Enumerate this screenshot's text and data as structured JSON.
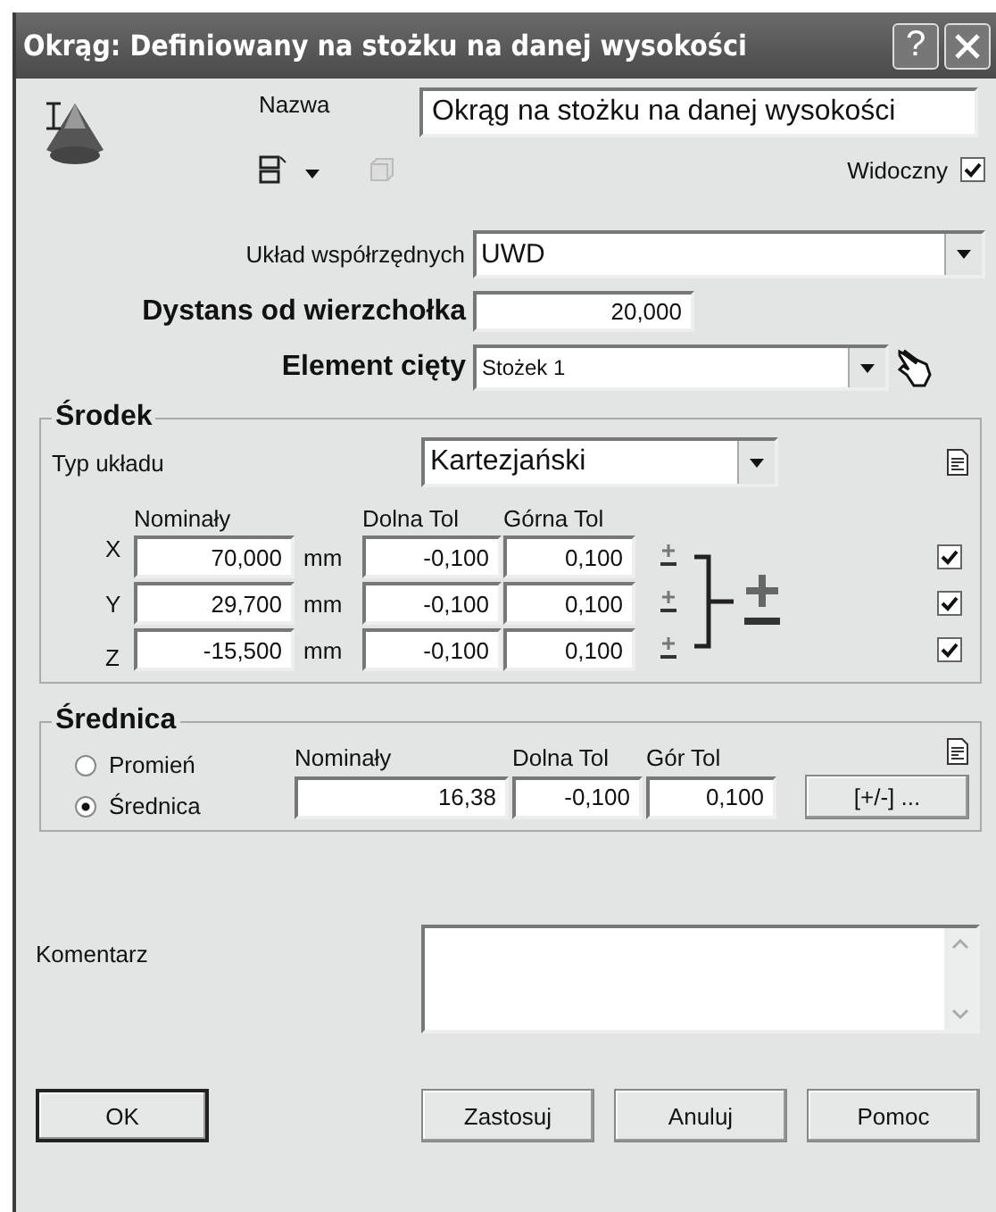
{
  "window": {
    "title": "Okrąg: Definiowany na stożku na danej wysokości",
    "help": "?"
  },
  "name": {
    "label": "Nazwa",
    "value": "Okrąg na stożku na danej wysokości"
  },
  "visible": {
    "label": "Widoczny",
    "checked": true
  },
  "coord_system": {
    "label": "Układ współrzędnych",
    "value": "UWD"
  },
  "distance": {
    "label": "Dystans od wierzchołka",
    "value": "20,000"
  },
  "cut_element": {
    "label": "Element cięty",
    "value": "Stożek 1"
  },
  "center": {
    "title": "Środek",
    "type_label": "Typ układu",
    "type_value": "Kartezjański",
    "columns": [
      "Nominały",
      "Dolna Tol",
      "Górna Tol"
    ],
    "rows": [
      {
        "axis": "X",
        "nominal": "70,000",
        "unit": "mm",
        "lower": "-0,100",
        "upper": "0,100",
        "checked": true
      },
      {
        "axis": "Y",
        "nominal": "29,700",
        "unit": "mm",
        "lower": "-0,100",
        "upper": "0,100",
        "checked": true
      },
      {
        "axis": "Z",
        "nominal": "-15,500",
        "unit": "mm",
        "lower": "-0,100",
        "upper": "0,100",
        "checked": true
      }
    ]
  },
  "diameter": {
    "title": "Średnica",
    "options": [
      {
        "label": "Promień",
        "selected": false
      },
      {
        "label": "Średnica",
        "selected": true
      }
    ],
    "columns": [
      "Nominały",
      "Dolna Tol",
      "Gór Tol"
    ],
    "nominal": "16,38",
    "lower": "-0,100",
    "upper": "0,100",
    "tol_button": "[+/-] ..."
  },
  "comment": {
    "label": "Komentarz"
  },
  "buttons": [
    {
      "label": "OK",
      "default": true
    },
    {
      "label": "Zastosuj",
      "default": false
    },
    {
      "label": "Anuluj",
      "default": false
    },
    {
      "label": "Pomoc",
      "default": false
    }
  ]
}
